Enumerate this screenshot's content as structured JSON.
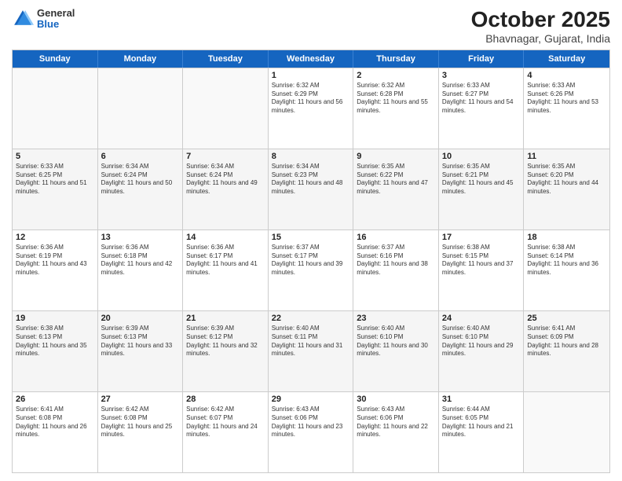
{
  "header": {
    "logo_general": "General",
    "logo_blue": "Blue",
    "month_title": "October 2025",
    "subtitle": "Bhavnagar, Gujarat, India"
  },
  "weekdays": [
    "Sunday",
    "Monday",
    "Tuesday",
    "Wednesday",
    "Thursday",
    "Friday",
    "Saturday"
  ],
  "rows": [
    [
      {
        "day": "",
        "sunrise": "",
        "sunset": "",
        "daylight": ""
      },
      {
        "day": "",
        "sunrise": "",
        "sunset": "",
        "daylight": ""
      },
      {
        "day": "",
        "sunrise": "",
        "sunset": "",
        "daylight": ""
      },
      {
        "day": "1",
        "sunrise": "Sunrise: 6:32 AM",
        "sunset": "Sunset: 6:29 PM",
        "daylight": "Daylight: 11 hours and 56 minutes."
      },
      {
        "day": "2",
        "sunrise": "Sunrise: 6:32 AM",
        "sunset": "Sunset: 6:28 PM",
        "daylight": "Daylight: 11 hours and 55 minutes."
      },
      {
        "day": "3",
        "sunrise": "Sunrise: 6:33 AM",
        "sunset": "Sunset: 6:27 PM",
        "daylight": "Daylight: 11 hours and 54 minutes."
      },
      {
        "day": "4",
        "sunrise": "Sunrise: 6:33 AM",
        "sunset": "Sunset: 6:26 PM",
        "daylight": "Daylight: 11 hours and 53 minutes."
      }
    ],
    [
      {
        "day": "5",
        "sunrise": "Sunrise: 6:33 AM",
        "sunset": "Sunset: 6:25 PM",
        "daylight": "Daylight: 11 hours and 51 minutes."
      },
      {
        "day": "6",
        "sunrise": "Sunrise: 6:34 AM",
        "sunset": "Sunset: 6:24 PM",
        "daylight": "Daylight: 11 hours and 50 minutes."
      },
      {
        "day": "7",
        "sunrise": "Sunrise: 6:34 AM",
        "sunset": "Sunset: 6:24 PM",
        "daylight": "Daylight: 11 hours and 49 minutes."
      },
      {
        "day": "8",
        "sunrise": "Sunrise: 6:34 AM",
        "sunset": "Sunset: 6:23 PM",
        "daylight": "Daylight: 11 hours and 48 minutes."
      },
      {
        "day": "9",
        "sunrise": "Sunrise: 6:35 AM",
        "sunset": "Sunset: 6:22 PM",
        "daylight": "Daylight: 11 hours and 47 minutes."
      },
      {
        "day": "10",
        "sunrise": "Sunrise: 6:35 AM",
        "sunset": "Sunset: 6:21 PM",
        "daylight": "Daylight: 11 hours and 45 minutes."
      },
      {
        "day": "11",
        "sunrise": "Sunrise: 6:35 AM",
        "sunset": "Sunset: 6:20 PM",
        "daylight": "Daylight: 11 hours and 44 minutes."
      }
    ],
    [
      {
        "day": "12",
        "sunrise": "Sunrise: 6:36 AM",
        "sunset": "Sunset: 6:19 PM",
        "daylight": "Daylight: 11 hours and 43 minutes."
      },
      {
        "day": "13",
        "sunrise": "Sunrise: 6:36 AM",
        "sunset": "Sunset: 6:18 PM",
        "daylight": "Daylight: 11 hours and 42 minutes."
      },
      {
        "day": "14",
        "sunrise": "Sunrise: 6:36 AM",
        "sunset": "Sunset: 6:17 PM",
        "daylight": "Daylight: 11 hours and 41 minutes."
      },
      {
        "day": "15",
        "sunrise": "Sunrise: 6:37 AM",
        "sunset": "Sunset: 6:17 PM",
        "daylight": "Daylight: 11 hours and 39 minutes."
      },
      {
        "day": "16",
        "sunrise": "Sunrise: 6:37 AM",
        "sunset": "Sunset: 6:16 PM",
        "daylight": "Daylight: 11 hours and 38 minutes."
      },
      {
        "day": "17",
        "sunrise": "Sunrise: 6:38 AM",
        "sunset": "Sunset: 6:15 PM",
        "daylight": "Daylight: 11 hours and 37 minutes."
      },
      {
        "day": "18",
        "sunrise": "Sunrise: 6:38 AM",
        "sunset": "Sunset: 6:14 PM",
        "daylight": "Daylight: 11 hours and 36 minutes."
      }
    ],
    [
      {
        "day": "19",
        "sunrise": "Sunrise: 6:38 AM",
        "sunset": "Sunset: 6:13 PM",
        "daylight": "Daylight: 11 hours and 35 minutes."
      },
      {
        "day": "20",
        "sunrise": "Sunrise: 6:39 AM",
        "sunset": "Sunset: 6:13 PM",
        "daylight": "Daylight: 11 hours and 33 minutes."
      },
      {
        "day": "21",
        "sunrise": "Sunrise: 6:39 AM",
        "sunset": "Sunset: 6:12 PM",
        "daylight": "Daylight: 11 hours and 32 minutes."
      },
      {
        "day": "22",
        "sunrise": "Sunrise: 6:40 AM",
        "sunset": "Sunset: 6:11 PM",
        "daylight": "Daylight: 11 hours and 31 minutes."
      },
      {
        "day": "23",
        "sunrise": "Sunrise: 6:40 AM",
        "sunset": "Sunset: 6:10 PM",
        "daylight": "Daylight: 11 hours and 30 minutes."
      },
      {
        "day": "24",
        "sunrise": "Sunrise: 6:40 AM",
        "sunset": "Sunset: 6:10 PM",
        "daylight": "Daylight: 11 hours and 29 minutes."
      },
      {
        "day": "25",
        "sunrise": "Sunrise: 6:41 AM",
        "sunset": "Sunset: 6:09 PM",
        "daylight": "Daylight: 11 hours and 28 minutes."
      }
    ],
    [
      {
        "day": "26",
        "sunrise": "Sunrise: 6:41 AM",
        "sunset": "Sunset: 6:08 PM",
        "daylight": "Daylight: 11 hours and 26 minutes."
      },
      {
        "day": "27",
        "sunrise": "Sunrise: 6:42 AM",
        "sunset": "Sunset: 6:08 PM",
        "daylight": "Daylight: 11 hours and 25 minutes."
      },
      {
        "day": "28",
        "sunrise": "Sunrise: 6:42 AM",
        "sunset": "Sunset: 6:07 PM",
        "daylight": "Daylight: 11 hours and 24 minutes."
      },
      {
        "day": "29",
        "sunrise": "Sunrise: 6:43 AM",
        "sunset": "Sunset: 6:06 PM",
        "daylight": "Daylight: 11 hours and 23 minutes."
      },
      {
        "day": "30",
        "sunrise": "Sunrise: 6:43 AM",
        "sunset": "Sunset: 6:06 PM",
        "daylight": "Daylight: 11 hours and 22 minutes."
      },
      {
        "day": "31",
        "sunrise": "Sunrise: 6:44 AM",
        "sunset": "Sunset: 6:05 PM",
        "daylight": "Daylight: 11 hours and 21 minutes."
      },
      {
        "day": "",
        "sunrise": "",
        "sunset": "",
        "daylight": ""
      }
    ]
  ]
}
